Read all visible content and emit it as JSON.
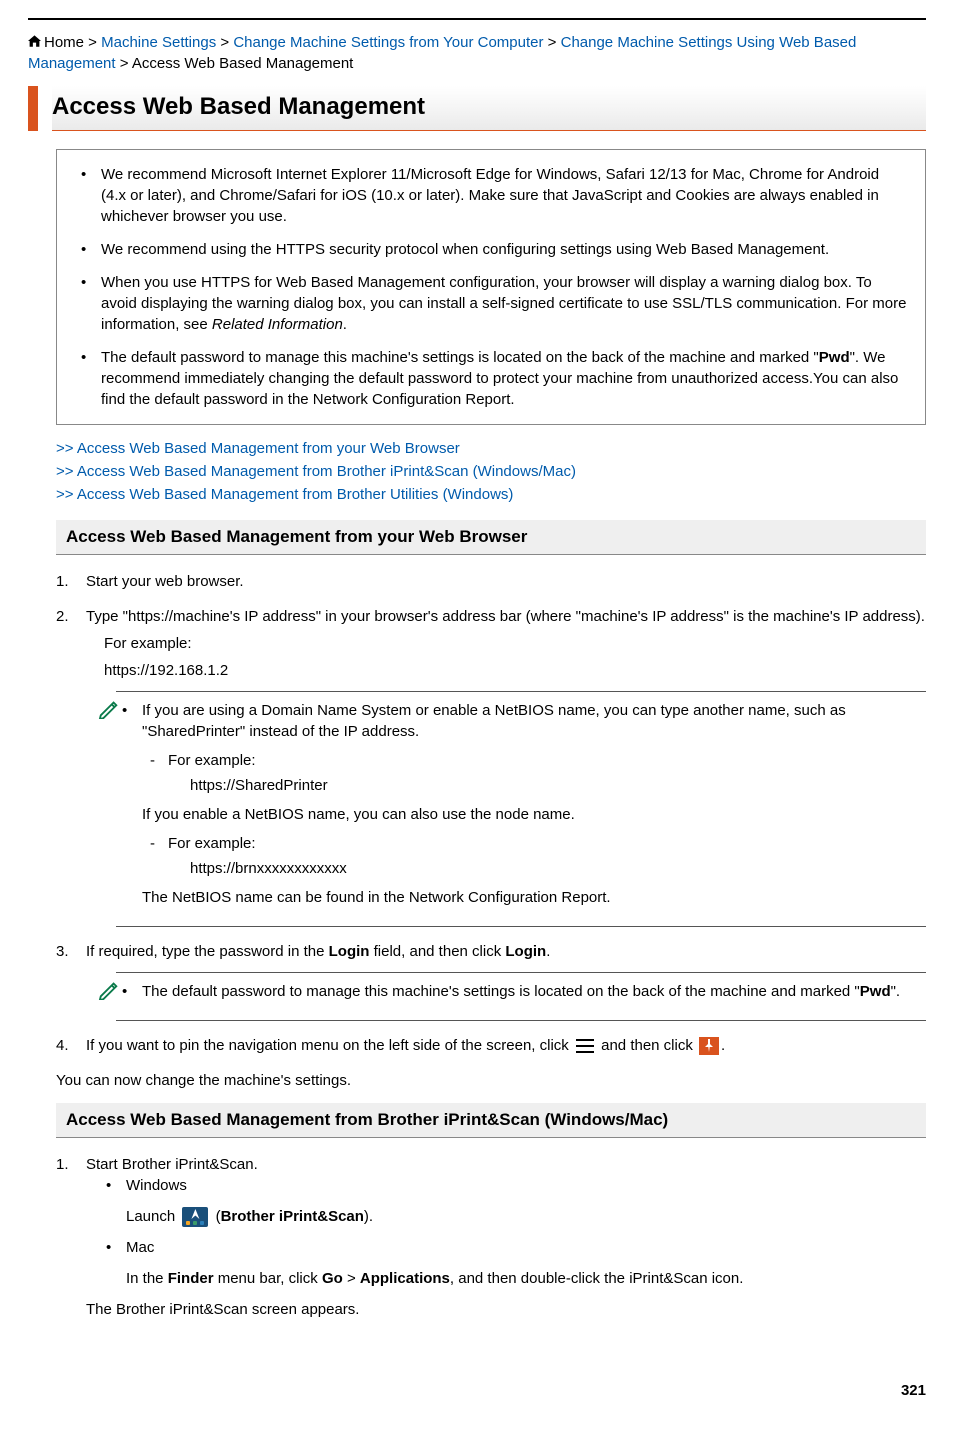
{
  "breadcrumb": {
    "home_label": "Home",
    "sep": " > ",
    "l1": "Machine Settings",
    "l2": "Change Machine Settings from Your Computer",
    "l3": "Change Machine Settings Using Web Based Management",
    "current": "Access Web Based Management"
  },
  "title": "Access Web Based Management",
  "recommendations": [
    "We recommend Microsoft Internet Explorer 11/Microsoft Edge for Windows, Safari 12/13 for Mac, Chrome for Android (4.x or later), and Chrome/Safari for iOS (10.x or later). Make sure that JavaScript and Cookies are always enabled in whichever browser you use.",
    "We recommend using the HTTPS security protocol when configuring settings using Web Based Management.",
    {
      "text": "When you use HTTPS for Web Based Management configuration, your browser will display a warning dialog box. To avoid displaying the warning dialog box, you can install a self-signed certificate to use SSL/TLS communication. For more information, see ",
      "em": "Related Information",
      "tail": "."
    },
    {
      "pre": "The default password to manage this machine's settings is located on the back of the machine and marked \"",
      "bold": "Pwd",
      "post": "\". We recommend immediately changing the default password to protect your machine from unauthorized access.You can also find the default password in the Network Configuration Report."
    }
  ],
  "jumps": {
    "j1": ">> Access Web Based Management from your Web Browser",
    "j2": ">> Access Web Based Management from Brother iPrint&Scan (Windows/Mac)",
    "j3": ">> Access Web Based Management from Brother Utilities (Windows)"
  },
  "section1": {
    "heading": "Access Web Based Management from your Web Browser",
    "step1": "Start your web browser.",
    "step2": "Type \"https://machine's IP address\" in your browser's address bar (where \"machine's IP address\" is the machine's IP address).",
    "step2_example_label": "For example:",
    "step2_example_url": "https://192.168.1.2",
    "note1_b1": "If you are using a Domain Name System or enable a NetBIOS name, you can type another name, such as \"SharedPrinter\" instead of the IP address.",
    "note1_for_example": "For example:",
    "note1_url1": "https://SharedPrinter",
    "note1_line2": "If you enable a NetBIOS name, you can also use the node name.",
    "note1_url2": "https://brnxxxxxxxxxxxx",
    "note1_line3": "The NetBIOS name can be found in the Network Configuration Report.",
    "step3_pre": "If required, type the password in the ",
    "step3_b1": "Login",
    "step3_mid": " field, and then click ",
    "step3_b2": "Login",
    "step3_post": ".",
    "note2_pre": "The default password to manage this machine's settings is located on the back of the machine and marked \"",
    "note2_bold": "Pwd",
    "note2_post": "\".",
    "step4_pre": "If you want to pin the navigation menu on the left side of the screen, click ",
    "step4_mid": " and then click ",
    "step4_post": ".",
    "closing": "You can now change the machine's settings."
  },
  "section2": {
    "heading": "Access Web Based Management from Brother iPrint&Scan (Windows/Mac)",
    "step1": "Start Brother iPrint&Scan.",
    "win_label": "Windows",
    "win_launch_pre": "Launch ",
    "win_launch_open": "(",
    "win_launch_bold": "Brother iPrint&Scan",
    "win_launch_close": ").",
    "mac_label": "Mac",
    "mac_pre": "In the ",
    "mac_b1": "Finder",
    "mac_mid1": " menu bar, click ",
    "mac_b2": "Go",
    "mac_sep": " > ",
    "mac_b3": "Applications",
    "mac_post": ", and then double-click the iPrint&Scan icon.",
    "mac_line2": "The Brother iPrint&Scan screen appears."
  },
  "page_number": "321"
}
